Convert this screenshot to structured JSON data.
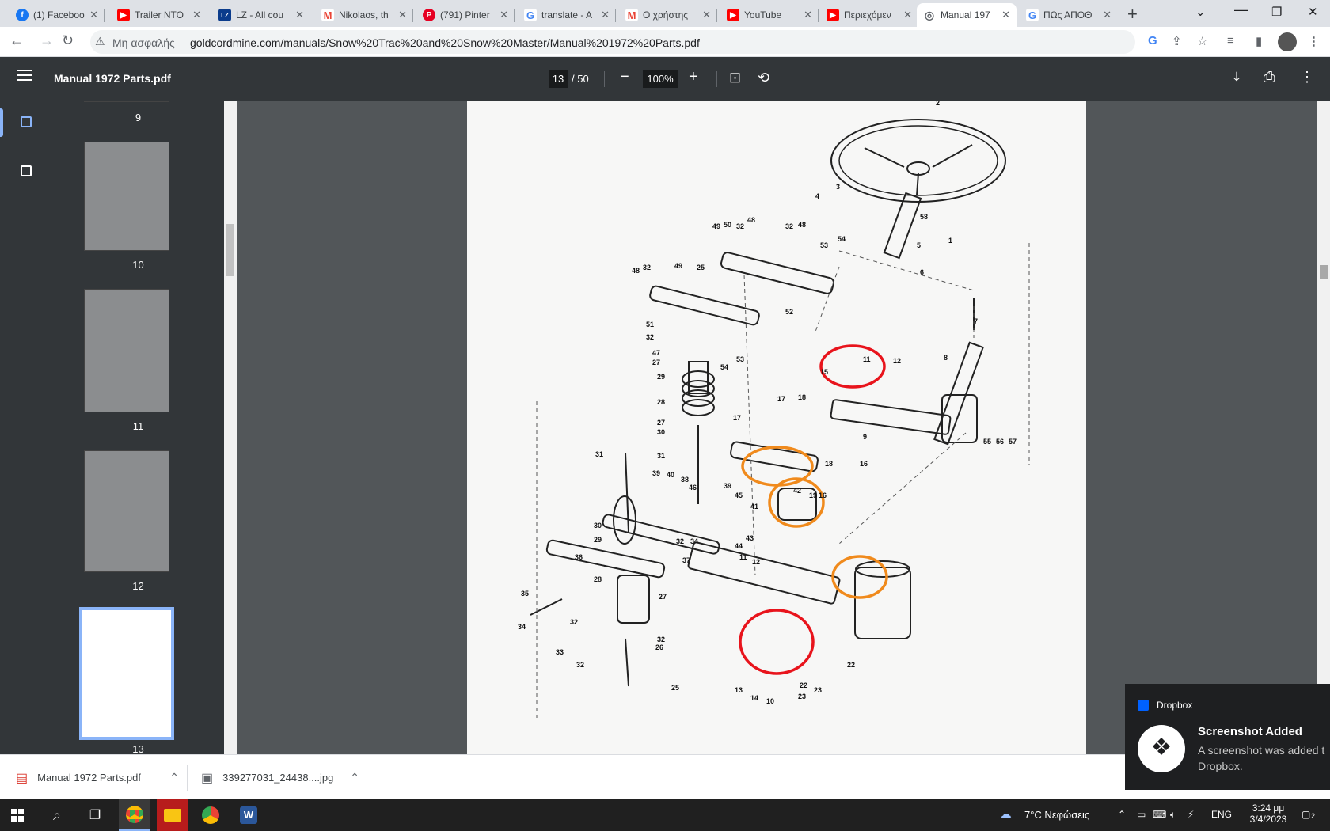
{
  "tabs": [
    {
      "label": "(1) Faceboo",
      "fav": "f",
      "color": "#1877f2"
    },
    {
      "label": "Trailer NTO",
      "fav": "▶",
      "color": "#ff0000"
    },
    {
      "label": "LZ - All cou",
      "fav": "LZ",
      "color": "#0b3c8c"
    },
    {
      "label": "Nikolaos, th",
      "fav": "M",
      "color": "#ea4335"
    },
    {
      "label": "(791) Pinter",
      "fav": "P",
      "color": "#e60023"
    },
    {
      "label": "translate - A",
      "fav": "G",
      "color": "#4285f4"
    },
    {
      "label": "Ο χρήστης",
      "fav": "M",
      "color": "#ea4335"
    },
    {
      "label": "YouTube",
      "fav": "▶",
      "color": "#ff0000"
    },
    {
      "label": "Περιεχόμεν",
      "fav": "▶",
      "color": "#ff0000"
    },
    {
      "label": "Manual 197",
      "fav": "◎",
      "color": "#5f6368",
      "active": true
    },
    {
      "label": "ΠΩς ΑΠΟΘ",
      "fav": "G",
      "color": "#4285f4"
    }
  ],
  "address": {
    "security": "Μη ασφαλής",
    "url": "goldcordmine.com/manuals/Snow%20Trac%20and%20Snow%20Master/Manual%201972%20Parts.pdf"
  },
  "pdf": {
    "title": "Manual 1972 Parts.pdf",
    "page": "13",
    "total": "/ 50",
    "zoom": "100%"
  },
  "thumbnails": [
    "9",
    "10",
    "11",
    "12",
    "13"
  ],
  "diagram_labels": {
    "n1": "1",
    "n2": "2",
    "n3": "3",
    "n4": "4",
    "n5": "5",
    "n6": "6",
    "n7": "7",
    "n8": "8",
    "n9": "9",
    "n10": "10",
    "n11": "11",
    "n12": "12",
    "n13": "13",
    "n14": "14",
    "n15": "15",
    "n16": "16",
    "n17": "17",
    "n18": "18",
    "n19": "19",
    "n22": "22",
    "n23": "23",
    "n25": "25",
    "n26": "26",
    "n27": "27",
    "n28": "28",
    "n29": "29",
    "n30": "30",
    "n31": "31",
    "n32": "32",
    "n33": "33",
    "n34": "34",
    "n35": "35",
    "n36": "36",
    "n37": "37",
    "n38": "38",
    "n39": "39",
    "n40": "40",
    "n41": "41",
    "n42": "42",
    "n43": "43",
    "n44": "44",
    "n45": "45",
    "n46": "46",
    "n47": "47",
    "n48": "48",
    "n49": "49",
    "n50": "50",
    "n51": "51",
    "n52": "52",
    "n53": "53",
    "n54": "54",
    "n55": "55",
    "n56": "56",
    "n57": "57",
    "n58": "58"
  },
  "downloads": [
    {
      "name": "Manual 1972 Parts.pdf"
    },
    {
      "name": "339277031_24438....jpg"
    }
  ],
  "toast": {
    "app": "Dropbox",
    "title": "Screenshot Added",
    "body": "A screenshot was added t Dropbox."
  },
  "tray": {
    "weather": "7°C  Νεφώσεις",
    "lang": "ENG",
    "time": "3:24 μμ",
    "date": "3/4/2023",
    "notif": "2"
  },
  "colors": {
    "accent": "#8ab4f8",
    "highlight_red": "#e8141c",
    "highlight_orange": "#f08a1c"
  }
}
